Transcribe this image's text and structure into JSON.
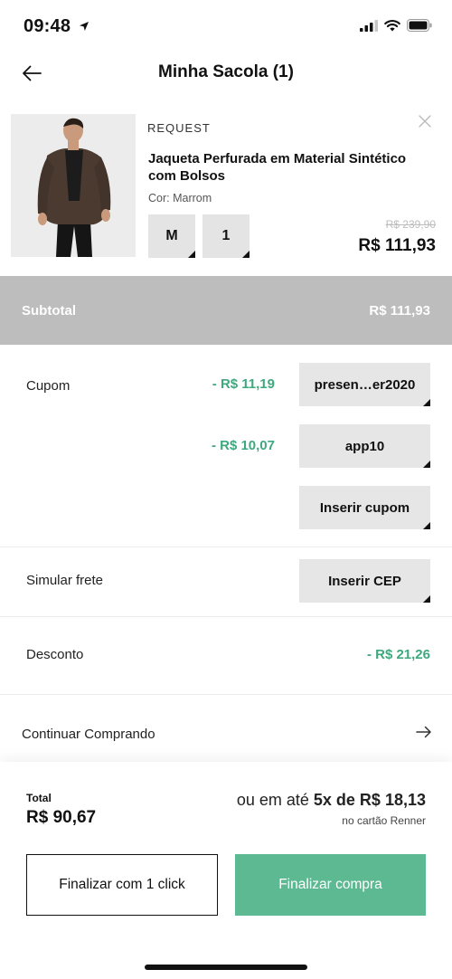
{
  "status_bar": {
    "time": "09:48"
  },
  "header": {
    "title": "Minha Sacola (1)"
  },
  "product": {
    "brand": "REQUEST",
    "name": "Jaqueta Perfurada em Material Sintético com Bolsos",
    "color": "Cor: Marrom",
    "size": "M",
    "quantity": "1",
    "old_price": "R$ 239,90",
    "price": "R$ 111,93"
  },
  "subtotal": {
    "label": "Subtotal",
    "value": "R$ 111,93"
  },
  "coupons": {
    "label": "Cupom",
    "items": [
      {
        "discount": "- R$ 11,19",
        "code": "presen…er2020"
      },
      {
        "discount": "- R$ 10,07",
        "code": "app10"
      }
    ],
    "add_label": "Inserir cupom"
  },
  "shipping": {
    "label": "Simular frete",
    "button": "Inserir CEP"
  },
  "discount": {
    "label": "Desconto",
    "value": "- R$ 21,26"
  },
  "continue": {
    "label": "Continuar Comprando"
  },
  "checkout": {
    "total_label": "Total",
    "total_value": "R$ 90,67",
    "installment_prefix": "ou em até",
    "installment_value": "5x de R$ 18,13",
    "installment_note": "no cartão Renner",
    "one_click_label": "Finalizar com 1 click",
    "finalize_label": "Finalizar compra"
  },
  "colors": {
    "accent": "#5db991",
    "discount_green": "#3ea87e",
    "subtotal_bar": "#bdbdbd"
  }
}
